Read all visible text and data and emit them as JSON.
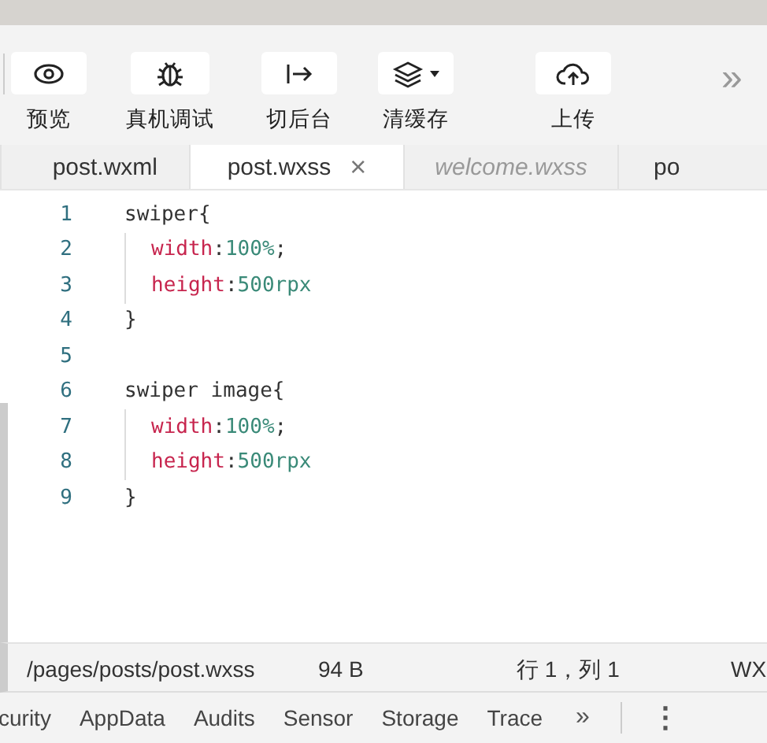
{
  "toolbar": {
    "buttons": [
      {
        "label": "预览",
        "dropdown": false
      },
      {
        "label": "真机调试",
        "dropdown": false
      },
      {
        "label": "切后台",
        "dropdown": false
      },
      {
        "label": "清缓存",
        "dropdown": true
      },
      {
        "label": "上传",
        "dropdown": false
      }
    ],
    "more": "»"
  },
  "tabs": [
    {
      "label": "post.wxml",
      "selected": false,
      "preview": false
    },
    {
      "label": "post.wxss",
      "selected": true,
      "preview": false,
      "close": "×"
    },
    {
      "label": "welcome.wxss",
      "selected": false,
      "preview": true
    },
    {
      "label": "po",
      "selected": false,
      "preview": false
    }
  ],
  "editor": {
    "lines": [
      {
        "number": "1",
        "kind": "rule",
        "tokens": [
          {
            "kind": "selector",
            "text": "swiper"
          },
          {
            "kind": "punct",
            "text": "{"
          }
        ]
      },
      {
        "number": "2",
        "kind": "declaration",
        "tokens": [
          {
            "kind": "property",
            "text": "width"
          },
          {
            "kind": "punct",
            "text": ":"
          },
          {
            "kind": "value",
            "text": "100%"
          },
          {
            "kind": "punct",
            "text": ";"
          }
        ]
      },
      {
        "number": "3",
        "kind": "declaration",
        "tokens": [
          {
            "kind": "property",
            "text": "height"
          },
          {
            "kind": "punct",
            "text": ":"
          },
          {
            "kind": "value",
            "text": "500rpx"
          }
        ]
      },
      {
        "number": "4",
        "kind": "rule",
        "tokens": [
          {
            "kind": "punct",
            "text": "}"
          }
        ]
      },
      {
        "number": "5",
        "kind": "rule"
      },
      {
        "number": "6",
        "kind": "rule",
        "tokens": [
          {
            "kind": "selector",
            "text": "swiper image"
          },
          {
            "kind": "punct",
            "text": "{"
          }
        ]
      },
      {
        "number": "7",
        "kind": "declaration",
        "tokens": [
          {
            "kind": "property",
            "text": "width"
          },
          {
            "kind": "punct",
            "text": ":"
          },
          {
            "kind": "value",
            "text": "100%"
          },
          {
            "kind": "punct",
            "text": ";"
          }
        ]
      },
      {
        "number": "8",
        "kind": "declaration",
        "tokens": [
          {
            "kind": "property",
            "text": "height"
          },
          {
            "kind": "punct",
            "text": ":"
          },
          {
            "kind": "value",
            "text": "500rpx"
          }
        ]
      },
      {
        "number": "9",
        "kind": "rule",
        "tokens": [
          {
            "kind": "punct",
            "text": "}"
          }
        ]
      }
    ]
  },
  "status_bar": {
    "path": "/pages/posts/post.wxss",
    "size": "94 B",
    "position": "行 1，列 1",
    "language": "WX"
  },
  "devtools_tabs": {
    "items": [
      "curity",
      "AppData",
      "Audits",
      "Sensor",
      "Storage",
      "Trace"
    ],
    "more": "»",
    "menu": "⋮"
  }
}
